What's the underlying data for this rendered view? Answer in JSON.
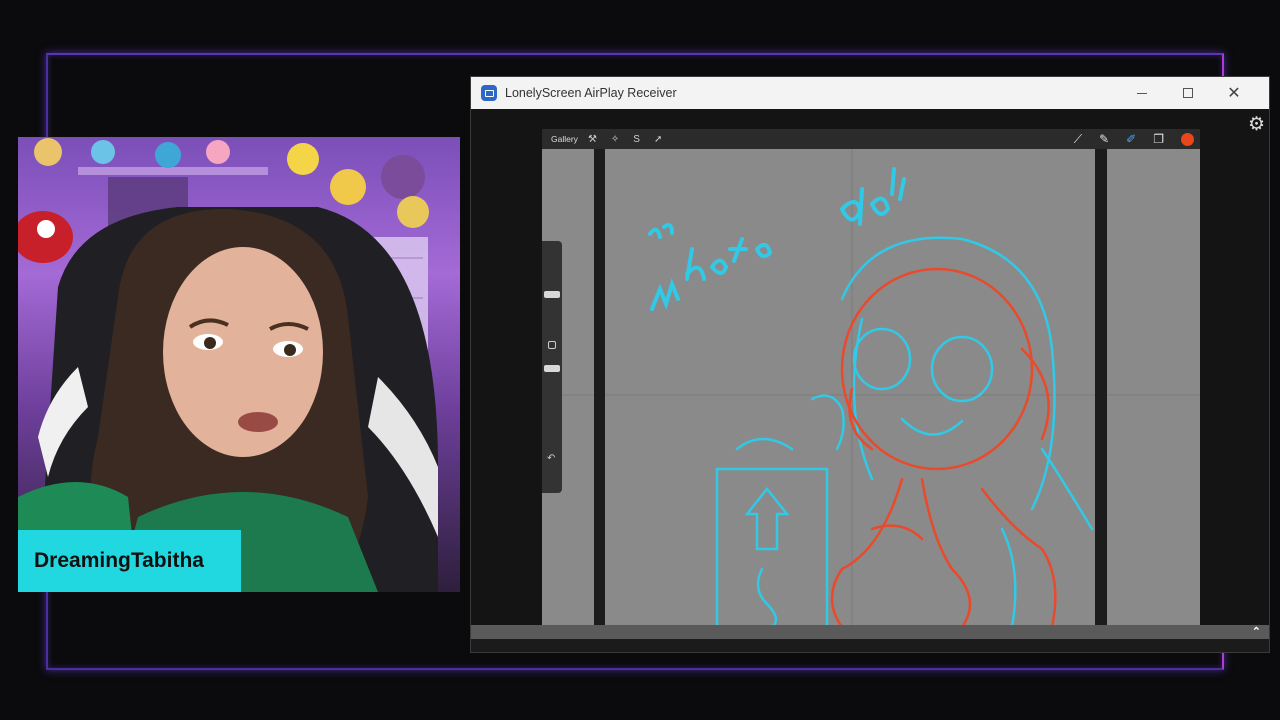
{
  "stream": {
    "streamer_name": "DreamingTabitha"
  },
  "window": {
    "title": "LonelyScreen AirPlay Receiver",
    "app_icon": "airplay-screen-icon",
    "controls": [
      "minimize",
      "maximize",
      "close"
    ]
  },
  "procreate": {
    "gallery_label": "Gallery",
    "left_tools": [
      "wrench-icon",
      "magic-wand-icon",
      "selection-icon",
      "transform-icon"
    ],
    "right_tools": [
      "brush-icon",
      "smudge-icon",
      "eraser-icon",
      "layers-icon",
      "color-icon"
    ],
    "active_color": "#e8461b",
    "sketch_colors": {
      "blue": "#31c9e6",
      "red": "#e94a2b"
    }
  },
  "icons": {
    "gear": "gear-icon",
    "expand": "chevron-up-icon"
  }
}
